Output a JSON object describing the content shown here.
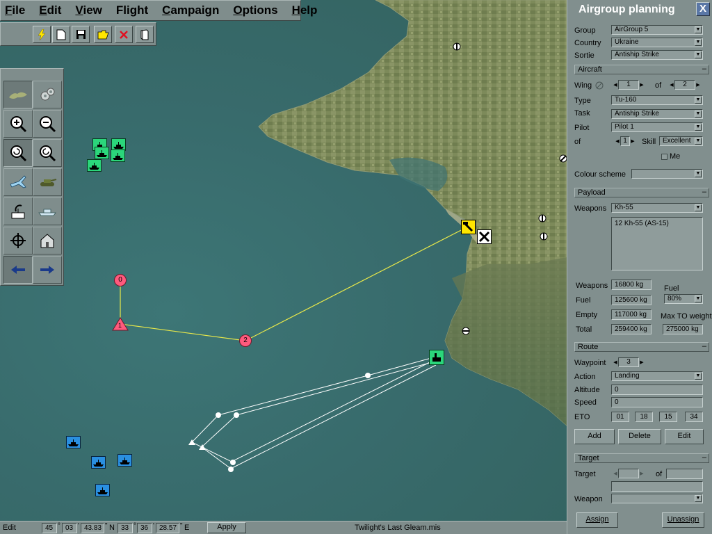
{
  "menu": {
    "items": [
      {
        "label": "File",
        "accel": "F",
        "rest": "ile"
      },
      {
        "label": "Edit",
        "accel": "E",
        "rest": "dit"
      },
      {
        "label": "View",
        "accel": "V",
        "rest": "iew"
      },
      {
        "label": "Flight",
        "accel": "",
        "rest": "Flight"
      },
      {
        "label": "Campaign",
        "accel": "C",
        "rest": "ampaign"
      },
      {
        "label": "Options",
        "accel": "O",
        "rest": "ptions"
      },
      {
        "label": "Help",
        "accel": "H",
        "rest": "elp"
      }
    ]
  },
  "toolbar": {
    "buttons": [
      "lightning-icon",
      "new-file-icon",
      "save-icon",
      "open-folder-icon",
      "delete-icon",
      "book-icon"
    ]
  },
  "palette": {
    "buttons": [
      "terrain-icon",
      "gears-icon",
      "zoom-in-icon",
      "zoom-out-icon",
      "zoom-reset-icon",
      "zoom-refresh-icon",
      "aircraft-icon",
      "tank-icon",
      "radar-icon",
      "ship-icon",
      "target-crosshair-icon",
      "building-icon",
      "arrow-back-icon",
      "arrow-forward-icon"
    ]
  },
  "map": {
    "waypoints": [
      {
        "label": "0"
      },
      {
        "label": "1"
      },
      {
        "label": "2"
      }
    ]
  },
  "status": {
    "mode": "Edit",
    "lat_deg": "45",
    "lat_min": "03",
    "lat_sec": "43.83",
    "lat_hemi": "N",
    "lon_deg": "33",
    "lon_min": "36",
    "lon_sec": "28.57",
    "lon_hemi": "E",
    "deg_symbol": "°",
    "min_symbol": "'",
    "sec_symbol": "\"",
    "apply_label": "Apply",
    "mission_name": "Twilight's Last Gleam.mis"
  },
  "panel": {
    "title": "Airgroup planning",
    "close_label": "X",
    "group_label": "Group",
    "group_value": "AirGroup 5",
    "country_label": "Country",
    "country_value": "Ukraine",
    "sortie_label": "Sortie",
    "sortie_value": "Antiship Strike",
    "aircraft_section": "Aircraft",
    "wing_label": "Wing",
    "wing_value": "1",
    "wing_of_label": "of",
    "wing_total": "2",
    "type_label": "Type",
    "type_value": "Tu-160",
    "task_label": "Task",
    "task_value": "Antiship Strike",
    "pilot_label": "Pilot",
    "pilot_value": "Pilot 1",
    "pilot_of_label": "of",
    "pilot_of_value": "1",
    "skill_label": "Skill",
    "skill_value": "Excellent",
    "me_label": "Me",
    "colour_label": "Colour scheme",
    "colour_value": "",
    "payload_section": "Payload",
    "weapons_label": "Weapons",
    "weapons_value": "Kh-55",
    "weapons_list": [
      "12 Kh-55 (AS-15)"
    ],
    "weapons_weight_label": "Weapons",
    "weapons_weight": "16800 kg",
    "fuel_weight_label": "Fuel",
    "fuel_weight": "125600 kg",
    "empty_weight_label": "Empty",
    "empty_weight": "117000 kg",
    "total_weight_label": "Total",
    "total_weight": "259400 kg",
    "fuel_header": "Fuel",
    "fuel_percent": "80%",
    "max_to_label": "Max TO weight",
    "max_to_weight": "275000 kg",
    "route_section": "Route",
    "waypoint_label": "Waypoint",
    "waypoint_value": "3",
    "action_label": "Action",
    "action_value": "Landing",
    "altitude_label": "Altitude",
    "altitude_value": "0",
    "speed_label": "Speed",
    "speed_value": "0",
    "eto_label": "ETO",
    "eto": [
      "01",
      "18",
      "15",
      "34"
    ],
    "add_label": "Add",
    "delete_label": "Delete",
    "edit_label": "Edit",
    "target_section": "Target",
    "target_label": "Target",
    "target_value": "",
    "target_of_label": "of",
    "target_of_value": "",
    "target_name": "",
    "target_weapon_label": "Weapon",
    "target_weapon_value": "",
    "assign_label": "Assign",
    "unassign_label": "Unassign",
    "collapse_symbol": "–"
  },
  "colors": {
    "sea": "#386b6c",
    "route_line": "#e8e84a",
    "waypoint_marker": "#ff5a7d",
    "friendly_unit": "#2bd67b",
    "enemy_unit": "#2a8fe0",
    "selected_unit": "#ffe600",
    "panel_bg": "#818f8e"
  }
}
